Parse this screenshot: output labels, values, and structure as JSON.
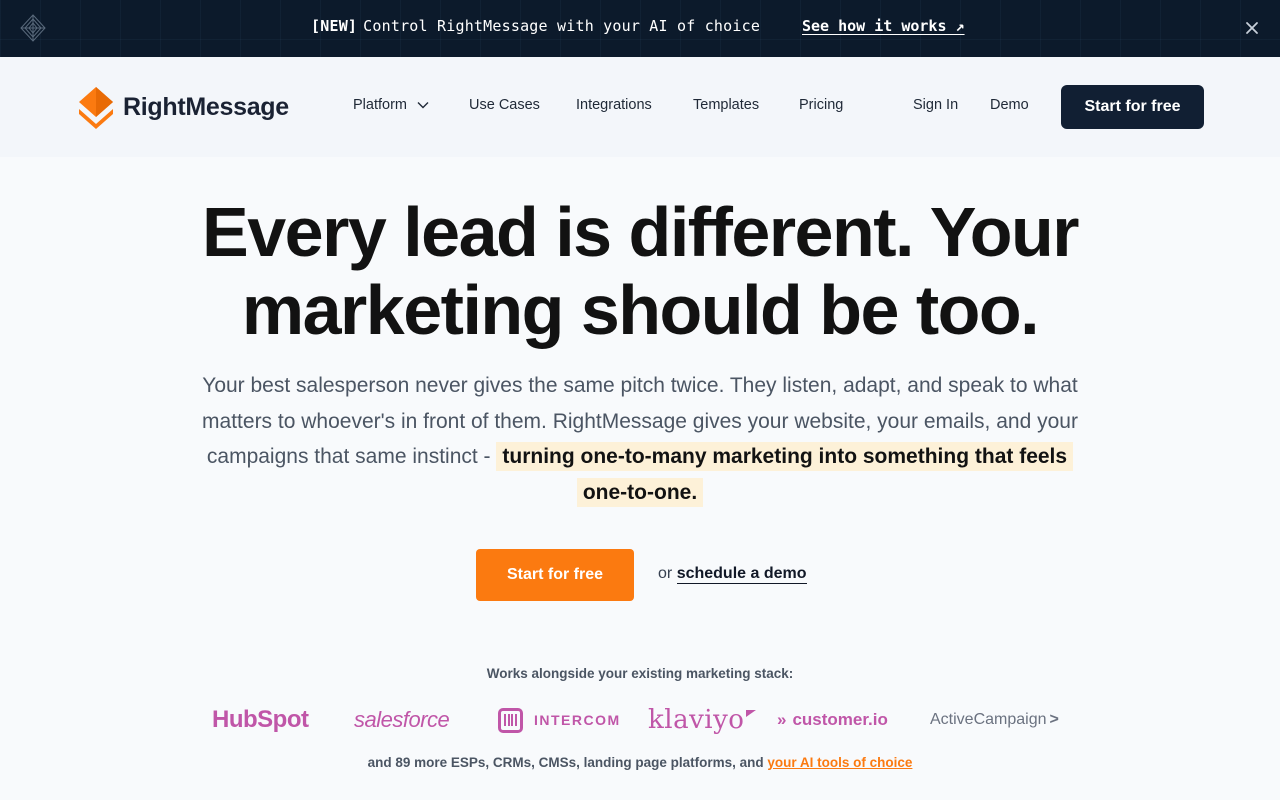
{
  "announcement": {
    "tag": "[NEW]",
    "message": "Control RightMessage with your AI of choice",
    "link": "See how it works ↗"
  },
  "header": {
    "brand": "RightMessage",
    "nav": [
      {
        "label": "Platform",
        "has_dropdown": true
      },
      {
        "label": "Use Cases"
      },
      {
        "label": "Integrations"
      },
      {
        "label": "Templates"
      },
      {
        "label": "Pricing"
      }
    ],
    "sign_in": "Sign In",
    "demo": "Demo",
    "cta": "Start for free"
  },
  "hero": {
    "title_line1": "Every lead is different. Your",
    "title_line2": "marketing should be too.",
    "sub_plain": "Your best salesperson never gives the same pitch twice. They listen, adapt, and speak to what matters to whoever's in front of them. RightMessage gives your website, your emails, and your campaigns that same instinct - ",
    "sub_highlight": "turning one-to-many marketing into something that feels one-to-one.",
    "cta": "Start for free",
    "or": "or",
    "demo_link": "schedule a demo"
  },
  "integrations": {
    "heading": "Works alongside your existing marketing stack:",
    "logos": [
      "HubSpot",
      "salesforce",
      "INTERCOM",
      "klaviyo",
      "customer.io",
      "ActiveCampaign"
    ],
    "more_prefix": "and 89 more ESPs, CRMs, CMSs, landing page platforms, and ",
    "more_link": "your AI tools of choice"
  },
  "colors": {
    "brand_orange": "#fb7a10",
    "dark_navy": "#111f33",
    "logo_pink": "#c056a8",
    "highlight": "#fdf1d8"
  }
}
